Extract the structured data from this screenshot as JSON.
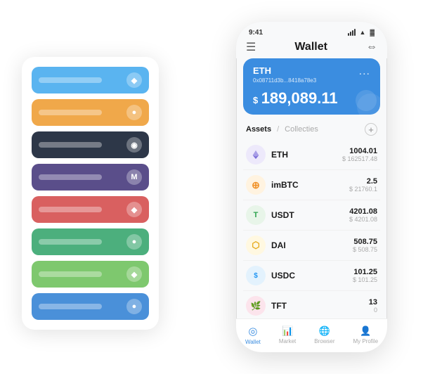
{
  "scene": {
    "background": "#ffffff"
  },
  "cardStack": {
    "cards": [
      {
        "id": "card-1",
        "colorClass": "card-blue",
        "icon": "◆"
      },
      {
        "id": "card-2",
        "colorClass": "card-orange",
        "icon": "●"
      },
      {
        "id": "card-3",
        "colorClass": "card-dark",
        "icon": "◉"
      },
      {
        "id": "card-4",
        "colorClass": "card-purple",
        "icon": "M"
      },
      {
        "id": "card-5",
        "colorClass": "card-red",
        "icon": "◆"
      },
      {
        "id": "card-6",
        "colorClass": "card-green",
        "icon": "●"
      },
      {
        "id": "card-7",
        "colorClass": "card-light-green",
        "icon": "◆"
      },
      {
        "id": "card-8",
        "colorClass": "card-blue2",
        "icon": "●"
      }
    ]
  },
  "phone": {
    "statusBar": {
      "time": "9:41"
    },
    "header": {
      "title": "Wallet",
      "hamburger": "☰",
      "scan": "⇔"
    },
    "ethCard": {
      "name": "ETH",
      "address": "0x08711d3b...8418a78e3",
      "more": "...",
      "balanceSymbol": "$",
      "balance": "189,089.11"
    },
    "assetsSection": {
      "tabActive": "Assets",
      "divider": "/",
      "tabInactive": "Collecties",
      "addIcon": "+"
    },
    "assets": [
      {
        "symbol": "ETH",
        "iconText": "♦",
        "iconClass": "icon-eth",
        "amount": "1004.01",
        "usd": "$ 162517.48"
      },
      {
        "symbol": "imBTC",
        "iconText": "⊕",
        "iconClass": "icon-imbtc",
        "amount": "2.5",
        "usd": "$ 21760.1"
      },
      {
        "symbol": "USDT",
        "iconText": "T",
        "iconClass": "icon-usdt",
        "amount": "4201.08",
        "usd": "$ 4201.08"
      },
      {
        "symbol": "DAI",
        "iconText": "⬡",
        "iconClass": "icon-dai",
        "amount": "508.75",
        "usd": "$ 508.75"
      },
      {
        "symbol": "USDC",
        "iconText": "$",
        "iconClass": "icon-usdc",
        "amount": "101.25",
        "usd": "$ 101.25"
      },
      {
        "symbol": "TFT",
        "iconText": "🌿",
        "iconClass": "icon-tft",
        "amount": "13",
        "usd": "0"
      }
    ],
    "bottomNav": [
      {
        "id": "wallet",
        "icon": "◎",
        "label": "Wallet",
        "active": true
      },
      {
        "id": "market",
        "icon": "📈",
        "label": "Market",
        "active": false
      },
      {
        "id": "browser",
        "icon": "🌐",
        "label": "Browser",
        "active": false
      },
      {
        "id": "profile",
        "icon": "👤",
        "label": "My Profile",
        "active": false
      }
    ]
  }
}
